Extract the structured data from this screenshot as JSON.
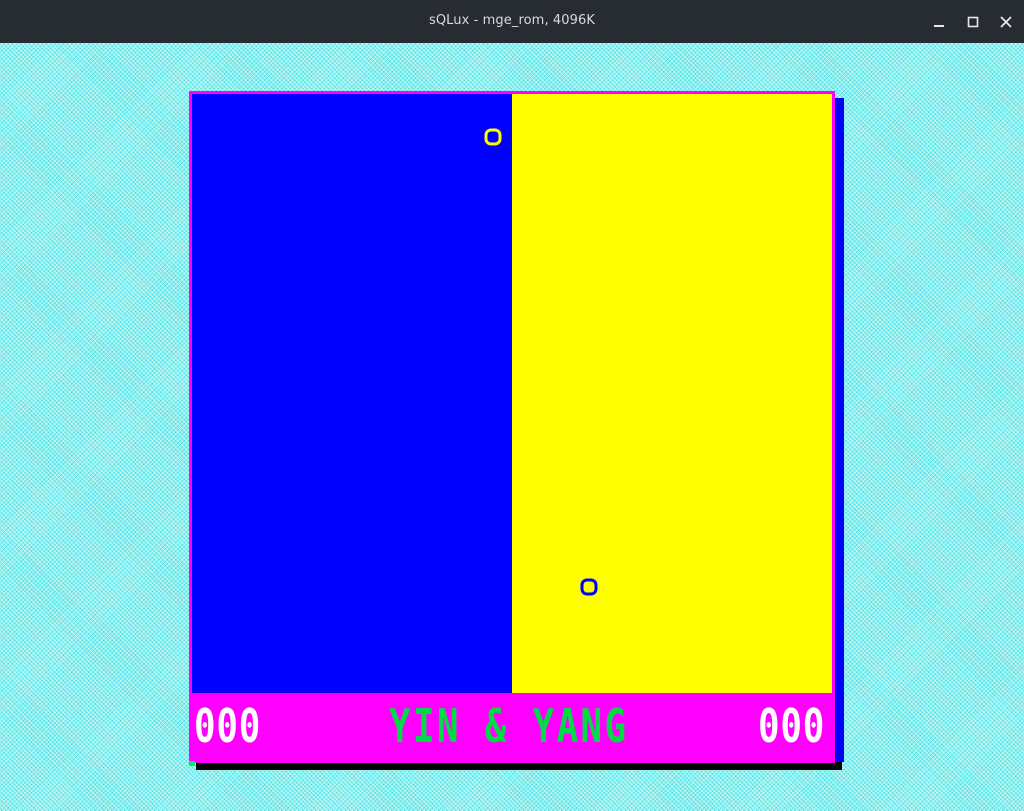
{
  "window": {
    "title": "sQLux - mge_rom, 4096K",
    "controls": {
      "minimize_icon": "minimize-icon",
      "maximize_icon": "maximize-icon",
      "close_icon": "close-icon"
    }
  },
  "game": {
    "title": "YIN & YANG",
    "score_left": "000",
    "score_right": "000",
    "ball_left_label": "o",
    "ball_right_label": "o"
  },
  "colors": {
    "titlebar": "#262c32",
    "desktop": "#8ff0f0",
    "frame": "#ff00ff",
    "yin_panel": "#0000ff",
    "yang_panel": "#ffff00",
    "score_text": "#ffffff",
    "title_text": "#00dd44"
  }
}
